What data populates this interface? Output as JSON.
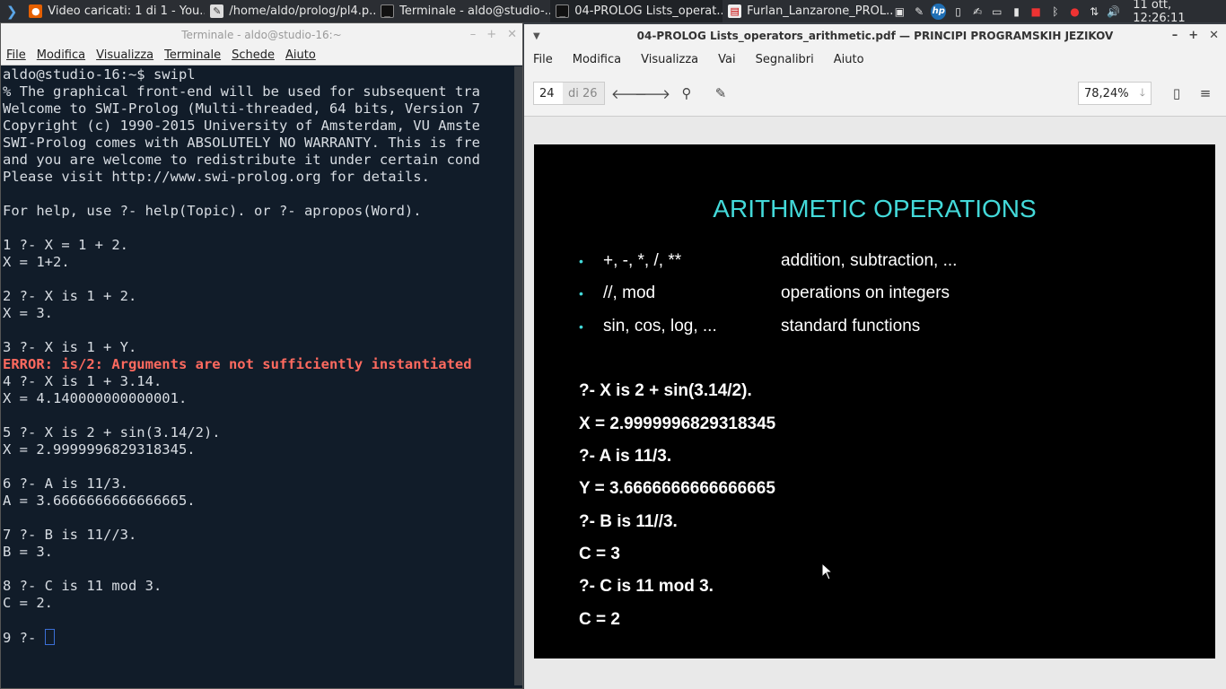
{
  "taskbar": {
    "tasks": [
      {
        "label": "Video caricati: 1 di 1 - You..."
      },
      {
        "label": "/home/aldo/prolog/pl4.p..."
      },
      {
        "label": "Terminale - aldo@studio-..."
      },
      {
        "label": "04-PROLOG Lists_operat..."
      },
      {
        "label": "Furlan_Lanzarone_PROL..."
      }
    ],
    "clock": "11 ott, 12:26:11"
  },
  "terminal": {
    "title": "Terminale - aldo@studio-16:~",
    "menu": [
      "File",
      "Modifica",
      "Visualizza",
      "Terminale",
      "Schede",
      "Aiuto"
    ],
    "lines": [
      {
        "text": "aldo@studio-16:~$ swipl",
        "type": "normal"
      },
      {
        "text": "% The graphical front-end will be used for subsequent tra",
        "type": "normal"
      },
      {
        "text": "Welcome to SWI-Prolog (Multi-threaded, 64 bits, Version 7",
        "type": "normal"
      },
      {
        "text": "Copyright (c) 1990-2015 University of Amsterdam, VU Amste",
        "type": "normal"
      },
      {
        "text": "SWI-Prolog comes with ABSOLUTELY NO WARRANTY. This is fre",
        "type": "normal"
      },
      {
        "text": "and you are welcome to redistribute it under certain cond",
        "type": "normal"
      },
      {
        "text": "Please visit http://www.swi-prolog.org for details.",
        "type": "normal"
      },
      {
        "text": "",
        "type": "normal"
      },
      {
        "text": "For help, use ?- help(Topic). or ?- apropos(Word).",
        "type": "normal"
      },
      {
        "text": "",
        "type": "normal"
      },
      {
        "text": "1 ?- X = 1 + 2.",
        "type": "normal"
      },
      {
        "text": "X = 1+2.",
        "type": "normal"
      },
      {
        "text": "",
        "type": "normal"
      },
      {
        "text": "2 ?- X is 1 + 2.",
        "type": "normal"
      },
      {
        "text": "X = 3.",
        "type": "normal"
      },
      {
        "text": "",
        "type": "normal"
      },
      {
        "text": "3 ?- X is 1 + Y.",
        "type": "normal"
      },
      {
        "text": "ERROR: is/2: Arguments are not sufficiently instantiated",
        "type": "error"
      },
      {
        "text": "4 ?- X is 1 + 3.14.",
        "type": "normal"
      },
      {
        "text": "X = 4.140000000000001.",
        "type": "normal"
      },
      {
        "text": "",
        "type": "normal"
      },
      {
        "text": "5 ?- X is 2 + sin(3.14/2).",
        "type": "normal"
      },
      {
        "text": "X = 2.9999996829318345.",
        "type": "normal"
      },
      {
        "text": "",
        "type": "normal"
      },
      {
        "text": "6 ?- A is 11/3.",
        "type": "normal"
      },
      {
        "text": "A = 3.6666666666666665.",
        "type": "normal"
      },
      {
        "text": "",
        "type": "normal"
      },
      {
        "text": "7 ?- B is 11//3.",
        "type": "normal"
      },
      {
        "text": "B = 3.",
        "type": "normal"
      },
      {
        "text": "",
        "type": "normal"
      },
      {
        "text": "8 ?- C is 11 mod 3.",
        "type": "normal"
      },
      {
        "text": "C = 2.",
        "type": "normal"
      },
      {
        "text": "",
        "type": "normal"
      }
    ],
    "prompt": "9 ?- "
  },
  "pdf": {
    "title": "04-PROLOG Lists_operators_arithmetic.pdf — PRINCIPI PROGRAMSKIH JEZIKOV",
    "menu": [
      "File",
      "Modifica",
      "Visualizza",
      "Vai",
      "Segnalibri",
      "Aiuto"
    ],
    "page_current": "24",
    "page_total": "di 26",
    "zoom": "78,24%",
    "slide": {
      "title": "ARITHMETIC OPERATIONS",
      "bullets": [
        {
          "left": "+,  -,  *,  /,  **",
          "right": "addition, subtraction, ..."
        },
        {
          "left": "//, mod",
          "right": "operations on integers"
        },
        {
          "left": "sin, cos, log, ...",
          "right": "standard functions"
        }
      ],
      "code": [
        "?-  X  is  2 + sin(3.14/2).",
        "X = 2.9999996829318345",
        "?- A is 11/3.",
        "Y = 3.6666666666666665",
        "?- B  is 11//3.",
        "C = 3",
        "?- C  is  11 mod 3.",
        "C = 2"
      ]
    }
  },
  "icons": {
    "start": "whisker-menu-icon",
    "tray": [
      "terminal-icon",
      "edit-icon",
      "hp-icon",
      "file-icon",
      "notes-icon",
      "clipboard-icon",
      "battery-icon",
      "screen-icon",
      "bluetooth-icon",
      "record-icon",
      "network-icon",
      "volume-icon"
    ]
  }
}
